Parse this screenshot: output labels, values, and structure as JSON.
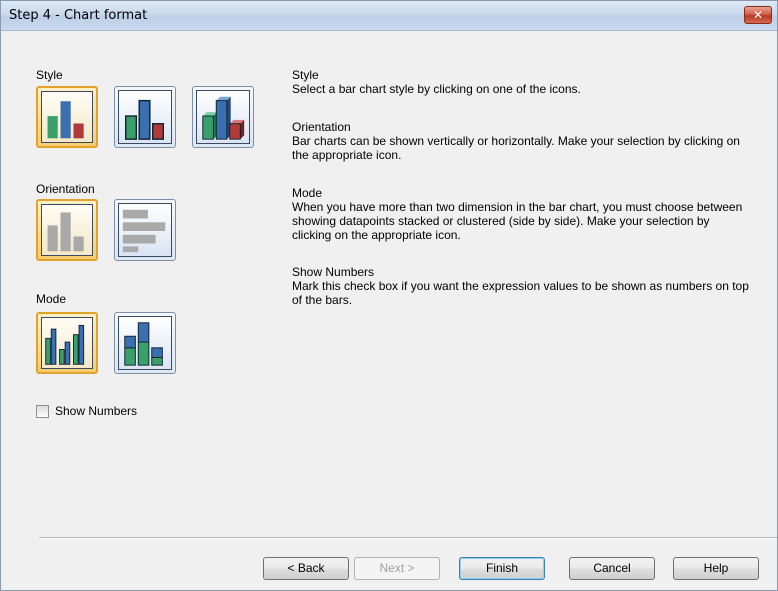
{
  "window": {
    "title": "Step 4 - Chart format",
    "close_glyph": "✕"
  },
  "left": {
    "style_label": "Style",
    "orientation_label": "Orientation",
    "mode_label": "Mode",
    "show_numbers_label": "Show Numbers",
    "show_numbers_checked": false
  },
  "help": {
    "style_title": "Style",
    "style_text": "Select a bar chart style by clicking on one of the icons.",
    "orientation_title": "Orientation",
    "orientation_text": "Bar charts can be shown vertically or horizontally. Make your selection by clicking on the appropriate icon.",
    "mode_title": "Mode",
    "mode_text": "When you have more than two dimension in the bar chart, you must choose between showing datapoints stacked or clustered (side by side). Make your selection by clicking on the appropriate icon.",
    "numbers_title": "Show Numbers",
    "numbers_text": "Mark this check box if you want the expression values to be shown as numbers on top of the bars."
  },
  "buttons": {
    "back": "< Back",
    "next": "Next >",
    "finish": "Finish",
    "cancel": "Cancel",
    "help": "Help"
  },
  "colors": {
    "green": "#3aa06a",
    "blue": "#3a6fb0",
    "red": "#b03a3a",
    "gray": "#a9a9a9",
    "selection": "#e2a32a"
  }
}
